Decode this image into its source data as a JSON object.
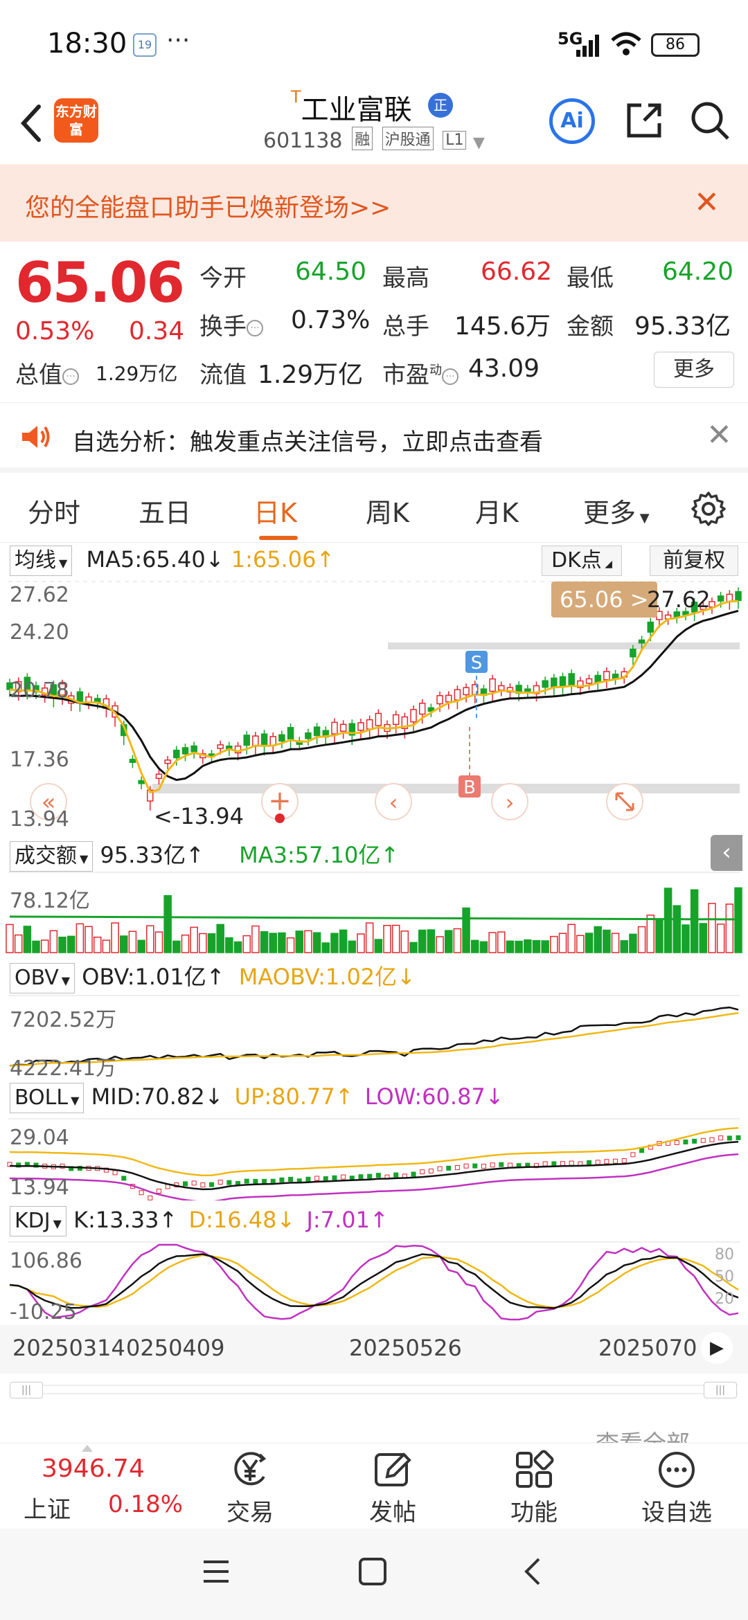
{
  "status_bar": {
    "time": "18:30",
    "calendar_icon_text": "19",
    "more": "···",
    "network": "5G",
    "battery": "86"
  },
  "header": {
    "logo_text": "东方财富",
    "title": "工业富联",
    "title_mark": "T",
    "title_badge": "正",
    "code": "601138",
    "tags": [
      "融",
      "沪股通",
      "L1"
    ],
    "ai_label": "Ai"
  },
  "banner": {
    "text": "您的全能盘口助手已焕新登场>>",
    "accent": "#e0561e"
  },
  "quote": {
    "price": "65.06",
    "change_pct": "0.53%",
    "change": "0.34",
    "open_label": "今开",
    "open": "64.50",
    "high_label": "最高",
    "high": "66.62",
    "low_label": "最低",
    "low": "64.20",
    "turnover_label": "换手",
    "turnover": "0.73%",
    "volume_label": "总手",
    "volume": "145.6万",
    "amount_label": "金额",
    "amount": "95.33亿",
    "mktcap_label": "总值",
    "mktcap": "1.29万亿",
    "float_label": "流值",
    "float": "1.29万亿",
    "pe_label": "市盈",
    "pe_sup": "动",
    "pe": "43.09",
    "more_label": "更多",
    "up_color": "#e0282e",
    "down_color": "#17a32a"
  },
  "notice": {
    "text": "自选分析：触发重点关注信号，立即点击查看"
  },
  "tabs": [
    {
      "label": "分时"
    },
    {
      "label": "五日"
    },
    {
      "label": "日K"
    },
    {
      "label": "周K"
    },
    {
      "label": "月K"
    },
    {
      "label": "更多"
    }
  ],
  "kchart": {
    "ma_select": "均线",
    "ma5": "MA5:65.40",
    "ma1": "1:65.06",
    "dk_label": "DK点",
    "fq_label": "前复权",
    "y_labels": [
      "27.62",
      "24.20",
      "20.78",
      "17.36",
      "13.94"
    ],
    "price_tag": "65.06 >",
    "price_tag2": "27.62",
    "low_marker": "<-13.94",
    "signal_s": "S",
    "signal_b": "B"
  },
  "volume": {
    "select": "成交额",
    "value": "95.33亿",
    "ma3": "MA3:57.10亿",
    "y_label": "78.12亿"
  },
  "obv": {
    "select": "OBV",
    "value": "OBV:1.01亿",
    "ma": "MAOBV:1.02亿",
    "y_labels": [
      "7202.52万",
      "4222.41万"
    ]
  },
  "boll": {
    "select": "BOLL",
    "mid": "MID:70.82",
    "up": "UP:80.77",
    "low": "LOW:60.87",
    "y_labels": [
      "29.04",
      "13.94"
    ]
  },
  "kdj": {
    "select": "KDJ",
    "k": "K:13.33",
    "d": "D:16.48",
    "j": "J:7.01",
    "y_labels": [
      "106.86",
      "-10.25"
    ],
    "right_labels": [
      "80",
      "50",
      "20"
    ]
  },
  "dates": [
    "20250314",
    "0250409",
    "20250526",
    "2025070"
  ],
  "bottom_nav": {
    "index_value": "3946.74",
    "index_name": "上证",
    "index_pct": "0.18%",
    "items": [
      {
        "label": "交易",
        "icon": "yen-icon"
      },
      {
        "label": "发帖",
        "icon": "edit-icon"
      },
      {
        "label": "功能",
        "icon": "grid-icon"
      },
      {
        "label": "设自选",
        "icon": "more-icon"
      }
    ]
  },
  "behind_text": "查看全部"
}
